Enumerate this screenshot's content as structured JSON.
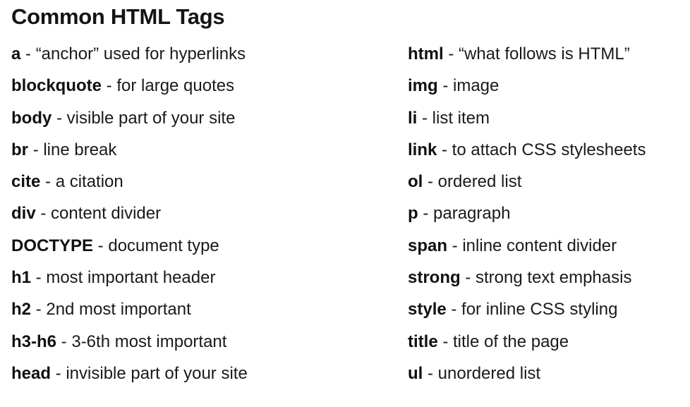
{
  "title": "Common HTML Tags",
  "separator": " - ",
  "left_column": [
    {
      "tag": "a",
      "desc": "“anchor” used for hyperlinks"
    },
    {
      "tag": "blockquote",
      "desc": "for large quotes"
    },
    {
      "tag": "body",
      "desc": "visible part of your site"
    },
    {
      "tag": "br",
      "desc": "line break"
    },
    {
      "tag": "cite",
      "desc": "a citation"
    },
    {
      "tag": "div",
      "desc": "content divider"
    },
    {
      "tag": "DOCTYPE",
      "desc": "document type"
    },
    {
      "tag": "h1",
      "desc": "most important header"
    },
    {
      "tag": "h2",
      "desc": "2nd most important"
    },
    {
      "tag": "h3-h6",
      "desc": "3-6th most important"
    },
    {
      "tag": "head",
      "desc": "invisible part of your site"
    }
  ],
  "right_column": [
    {
      "tag": "html",
      "desc": "“what follows is HTML”"
    },
    {
      "tag": "img",
      "desc": "image"
    },
    {
      "tag": "li",
      "desc": "list item"
    },
    {
      "tag": "link",
      "desc": "to attach CSS stylesheets"
    },
    {
      "tag": "ol",
      "desc": "ordered list"
    },
    {
      "tag": "p",
      "desc": "paragraph"
    },
    {
      "tag": "span",
      "desc": "inline content divider"
    },
    {
      "tag": "strong",
      "desc": "strong text emphasis"
    },
    {
      "tag": "style",
      "desc": "for inline CSS styling"
    },
    {
      "tag": "title",
      "desc": "title of the page"
    },
    {
      "tag": "ul",
      "desc": "unordered list"
    }
  ]
}
